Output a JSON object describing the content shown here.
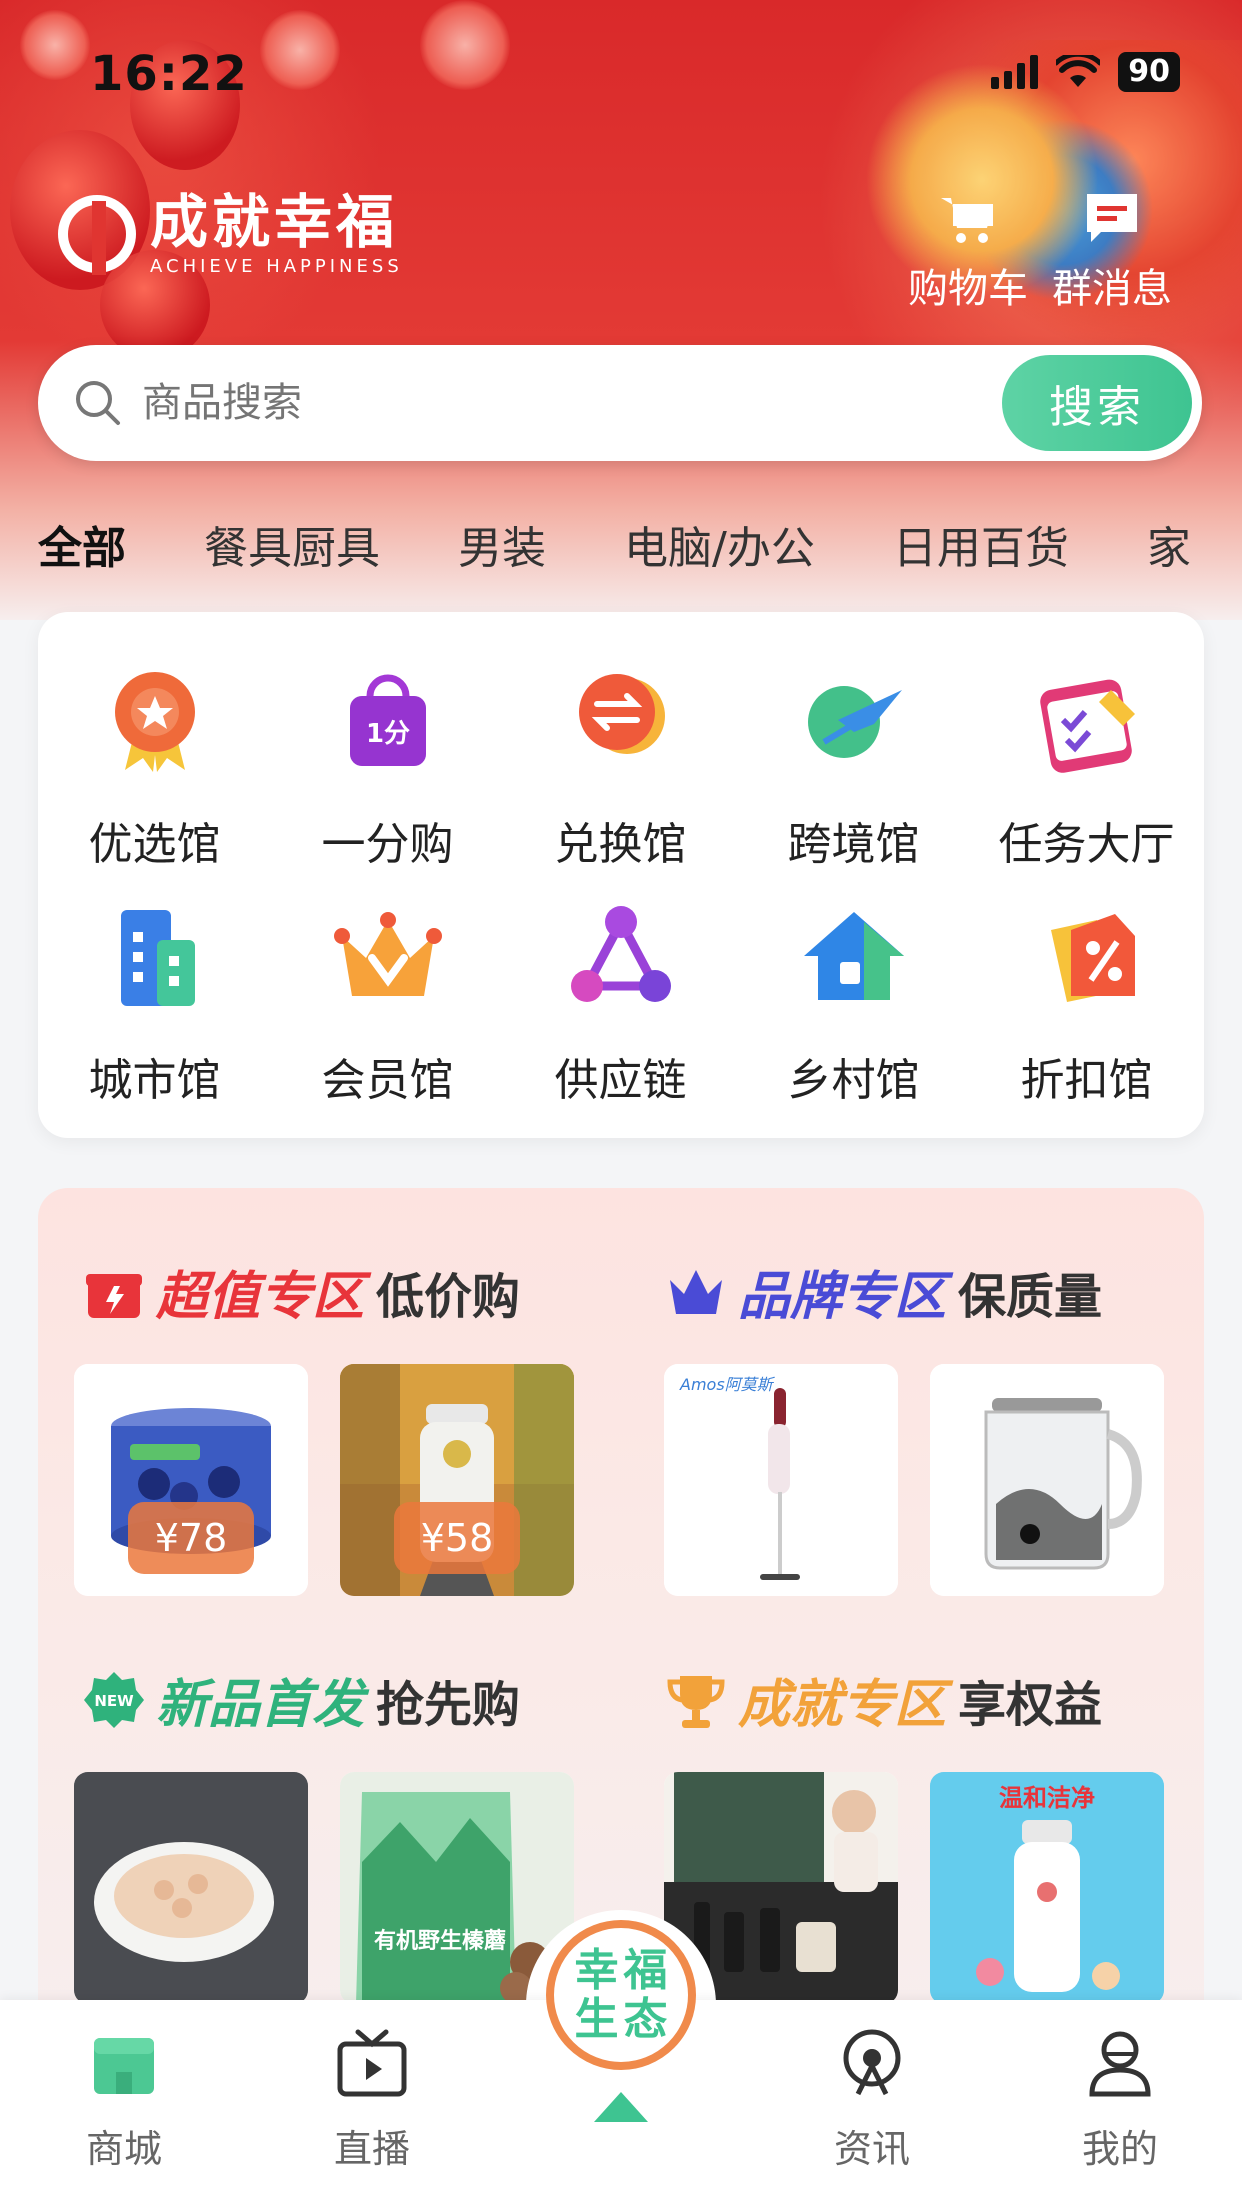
{
  "status_bar": {
    "time": "16:22",
    "battery": "90"
  },
  "brand": {
    "name_cn": "成就幸福",
    "name_en": "ACHIEVE HAPPINESS"
  },
  "header_actions": [
    {
      "label": "购物车",
      "icon": "cart-icon"
    },
    {
      "label": "群消息",
      "icon": "message-icon"
    }
  ],
  "search": {
    "placeholder": "商品搜索",
    "button_label": "搜索"
  },
  "categories": [
    "全部",
    "餐具厨具",
    "男装",
    "电脑/办公",
    "日用百货",
    "家"
  ],
  "grid": [
    {
      "label": "优选馆",
      "icon": "badge-star-icon"
    },
    {
      "label": "一分购",
      "icon": "shopping-bag-icon",
      "icon_text": "1分"
    },
    {
      "label": "兑换馆",
      "icon": "exchange-icon"
    },
    {
      "label": "跨境馆",
      "icon": "plane-icon"
    },
    {
      "label": "任务大厅",
      "icon": "calendar-icon"
    },
    {
      "label": "城市馆",
      "icon": "building-icon"
    },
    {
      "label": "会员馆",
      "icon": "crown-icon"
    },
    {
      "label": "供应链",
      "icon": "network-icon"
    },
    {
      "label": "乡村馆",
      "icon": "house-icon"
    },
    {
      "label": "折扣馆",
      "icon": "discount-tag-icon"
    }
  ],
  "zones": [
    {
      "title": "超值专区",
      "subtitle": "低价购",
      "color": "#e8343a",
      "icon": "gift-icon",
      "products": [
        {
          "price": "¥78",
          "image": "blueberry-tin"
        },
        {
          "price": "¥58",
          "image": "supplement-bottle"
        }
      ]
    },
    {
      "title": "品牌专区",
      "subtitle": "保质量",
      "color": "#4a4bd6",
      "icon": "crown-icon",
      "products": [
        {
          "brand_text": "Amos阿莫斯",
          "image": "stick-vacuum"
        },
        {
          "image": "glass-kettle"
        }
      ]
    },
    {
      "title": "新品首发",
      "subtitle": "抢先购",
      "color": "#2fb27c",
      "icon": "new-badge-icon",
      "badge": "NEW",
      "products": [
        {
          "image": "dried-shrimp"
        },
        {
          "image": "mushroom-pack",
          "pack_text": "有机野生榛蘑"
        }
      ]
    },
    {
      "title": "成就专区",
      "subtitle": "享权益",
      "color": "#f2a23a",
      "icon": "trophy-icon",
      "products": [
        {
          "image": "skincare-giftbox"
        },
        {
          "image": "cleanser-bottle",
          "banner_text": "温和洁净"
        }
      ]
    }
  ],
  "tabbar": [
    {
      "label": "商城",
      "icon": "shop-icon",
      "active": true
    },
    {
      "label": "直播",
      "icon": "tv-icon"
    },
    {
      "label": "",
      "icon": "center-logo-icon",
      "logo_chars": [
        "幸",
        "福",
        "生",
        "态"
      ]
    },
    {
      "label": "资讯",
      "icon": "broadcast-icon"
    },
    {
      "label": "我的",
      "icon": "user-icon"
    }
  ],
  "colors": {
    "accent_green": "#3ec491",
    "hero_red": "#d9292a"
  }
}
